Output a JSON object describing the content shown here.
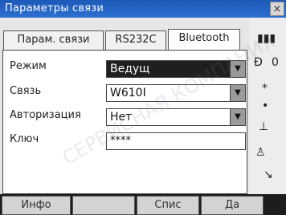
{
  "window": {
    "title": "Параметры связи",
    "close_label": "×"
  },
  "tabs": [
    {
      "label": "Парам. связи"
    },
    {
      "label": "RS232C"
    },
    {
      "label": "Bluetooth"
    }
  ],
  "form": {
    "mode_label": "Режим",
    "mode_value": "Ведущ",
    "link_label": "Связь",
    "link_value": "W610I",
    "auth_label": "Авторизация",
    "auth_value": "Нет",
    "key_label": "Ключ",
    "key_value": "****"
  },
  "softkeys": [
    "Инфо",
    "",
    "Спис",
    "Да"
  ],
  "watermark": "СЕРВИСНАЯ КОМПАНИЯ",
  "icons": [
    "battery-icon",
    "signal-icon",
    "target-icon",
    "star-icon",
    "prism-icon",
    "tilt-icon",
    "laser-icon",
    "scroll-icon"
  ]
}
